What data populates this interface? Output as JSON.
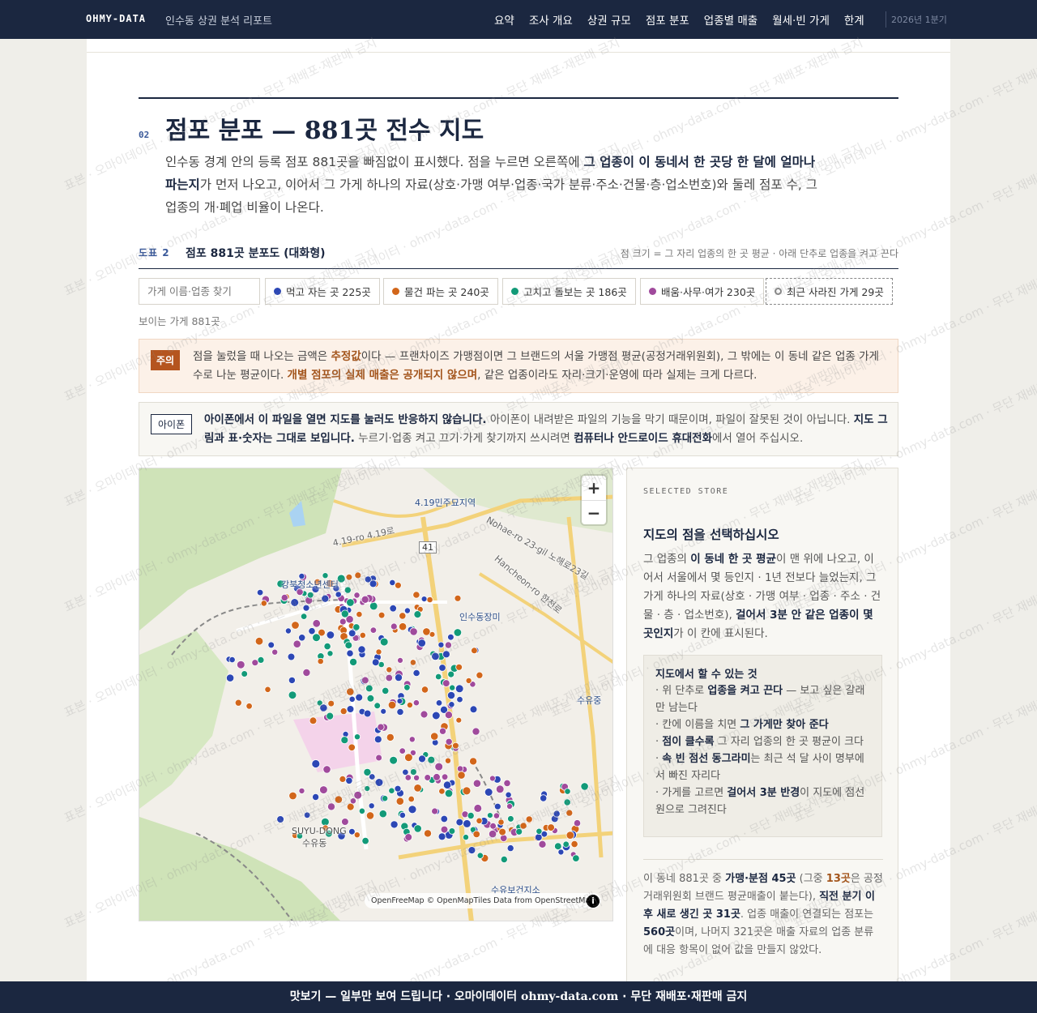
{
  "header": {
    "brand": "OHMY-DATA",
    "subtitle": "인수동 상권 분석 리포트",
    "nav": [
      "요약",
      "조사 개요",
      "상권 규모",
      "점포 분포",
      "업종별 매출",
      "월세·빈 가게",
      "한계"
    ],
    "period": "2026년 1분기"
  },
  "section": {
    "number": "02",
    "title": "점포 분포 — 881곳 전수 지도",
    "intro_1": "인수동 경계 안의 등록 점포 881곳을 빠짐없이 표시했다. 점을 누르면 오른쪽에 ",
    "intro_bold": "그 업종이 이 동네서 한 곳당 한 달에 얼마나 파는지",
    "intro_2": "가 먼저 나오고, 이어서 그 가게 하나의 자료(상호·가맹 여부·업종·국가 분류·주소·건물·층·업소번호)와 둘레 점포 수, 그 업종의 개·폐업 비율이 나온다."
  },
  "figure": {
    "label": "도표 2",
    "title": "점포 881곳 분포도 (대화형)",
    "note": "점 크기 = 그 자리 업종의 한 곳 평균 · 아래 단추로 업종을 켜고 끈다"
  },
  "filters": {
    "search_placeholder": "가게 이름·업종 찾기",
    "chips": [
      {
        "label": "먹고 자는 곳 225곳",
        "color": "#2c47b5"
      },
      {
        "label": "물건 파는 곳 240곳",
        "color": "#d2661a"
      },
      {
        "label": "고치고 돌보는 곳 186곳",
        "color": "#129a78"
      },
      {
        "label": "배움·사무·여가 230곳",
        "color": "#a04a9c"
      }
    ],
    "closed_label": "최근 사라진 가게 29곳",
    "visible_count": "보이는 가게 881곳"
  },
  "warning": {
    "tag": "주의",
    "text_1": "점을 눌렀을 때 나오는 금액은 ",
    "hl_1": "추정값",
    "text_2": "이다 — 프랜차이즈 가맹점이면 그 브랜드의 서울 가맹점 평균(공정거래위원회), 그 밖에는 이 동네 같은 업종 가게 수로 나눈 평균이다. ",
    "hl_2": "개별 점포의 실제 매출은 공개되지 않으며",
    "text_3": ", 같은 업종이라도 자리·크기·운영에 따라 실제는 크게 다르다."
  },
  "ios_note": {
    "tag": "아이폰",
    "bold_1": "아이폰에서 이 파일을 열면 지도를 눌러도 반응하지 않습니다.",
    "text_1": " 아이폰이 내려받은 파일의 기능을 막기 때문이며, 파일이 잘못된 것이 아닙니다. ",
    "bold_2": "지도 그림과 표·숫자는 그대로 보입니다.",
    "text_2": " 누르기·업종 켜고 끄기·가게 찾기까지 쓰시려면 ",
    "bold_3": "컴퓨터나 안드로이드 휴대전화",
    "text_3": "에서 열어 주십시오."
  },
  "map": {
    "zoom_in": "+",
    "zoom_out": "−",
    "attribution": "OpenFreeMap © OpenMapTiles Data from OpenStreetMap",
    "info": "i",
    "labels": [
      "4.19민주묘지역",
      "강북청소년센터",
      "인수동장미",
      "SUYU-DONG",
      "수유동",
      "수유보건지소",
      "4.19-ro 4.19로",
      "Nohae-ro 23-gil 노해로23길",
      "Hancheon-ro 한천로",
      "수유중",
      "41"
    ]
  },
  "panel": {
    "eyebrow": "SELECTED STORE",
    "title": "지도의 점을 선택하십시오",
    "body_1": "그 업종의 ",
    "body_b1": "이 동네 한 곳 평균",
    "body_2": "이 맨 위에 나오고, 이어서 서울에서 몇 등인지 · 1년 전보다 늘었는지, 그 가게 하나의 자료(상호 · 가맹 여부 · 업종 · 주소 · 건물 · 층 · 업소번호), ",
    "body_b2": "걸어서 3분 안 같은 업종이 몇 곳인지",
    "body_3": "가 이 칸에 표시된다.",
    "howto_title": "지도에서 할 수 있는 것",
    "howto": [
      {
        "a": "· 위 단추로 ",
        "b": "업종을 켜고 끈다",
        "c": " — 보고 싶은 갈래만 남는다"
      },
      {
        "a": "· 칸에 이름을 치면 ",
        "b": "그 가게만 찾아 준다",
        "c": ""
      },
      {
        "a": "· ",
        "b": "점이 클수록",
        "c": " 그 자리 업종의 한 곳 평균이 크다"
      },
      {
        "a": "· ",
        "b": "속 빈 점선 동그라미",
        "c": "는 최근 석 달 사이 명부에서 빠진 자리다"
      },
      {
        "a": "· 가게를 고르면 ",
        "b": "걸어서 3분 반경",
        "c": "이 지도에 점선 원으로 그려진다"
      }
    ],
    "stats_1": "이 동네 881곳 중 ",
    "stats_b1": "가맹·분점 45곳",
    "stats_2": " (그중 ",
    "stats_hl": "13곳",
    "stats_3": "은 공정거래위원회 브랜드 평균매출이 붙는다), ",
    "stats_b2": "직전 분기 이후 새로 생긴 곳 31곳",
    "stats_4": ". 업종 매출이 연결되는 점포는 ",
    "stats_b3": "560곳",
    "stats_5": "이며, 나머지 321곳은 매출 자료의 업종 분류에 대응 항목이 없어 값을 만들지 않았다."
  },
  "footer": {
    "text_1": "맛보기 — 일부만 보여 드립니다 · 오마이데이터 ",
    "site": "ohmy-data.com",
    "text_2": " · 무단 재배포·재판매 금지"
  },
  "watermark": "표본 · 오마이데이터 · ohmy-data.com · 무단 재배포·재판매 금지"
}
